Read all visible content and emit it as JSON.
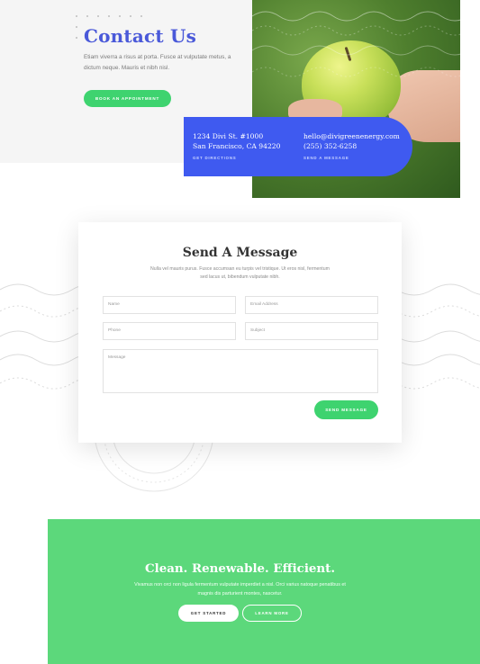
{
  "hero": {
    "title": "Contact Us",
    "text": "Etiam viverra a risus at porta. Fusce at vulputate metus, a dictum neque. Mauris et nibh nisl.",
    "button_label": "Book an appointment",
    "image_icon": "apple-in-hand-photo"
  },
  "contact_card": {
    "address_line1": "1234 Divi St. #1000",
    "address_line2": "San Francisco, CA 94220",
    "directions_label": "Get directions",
    "email": "hello@divigreenenergy.com",
    "phone": "(255) 352-6258",
    "send_label": "Send a message"
  },
  "form": {
    "title": "Send A Message",
    "description": "Nulla vel mauris purus. Fusce accumsan eu turpis vel tristique. Ut eros nisl, fermentum sed lacus ut, bibendum vulputate nibh.",
    "name_placeholder": "Name",
    "email_placeholder": "Email Address",
    "phone_placeholder": "Phone",
    "subject_placeholder": "Subject",
    "message_placeholder": "Message",
    "submit_label": "Send message"
  },
  "cta": {
    "title": "Clean. Renewable. Efficient.",
    "text": "Vivamus non orci non ligula fermentum vulputate imperdiet a nisl. Orci varius natoque penatibus et magnis dis parturient montes, nascetur.",
    "primary_label": "Get started",
    "secondary_label": "Learn more"
  },
  "colors": {
    "accent_blue": "#3f5af0",
    "title_blue": "#4a59d9",
    "accent_green": "#3ed36f",
    "cta_green": "#5cd87b"
  }
}
